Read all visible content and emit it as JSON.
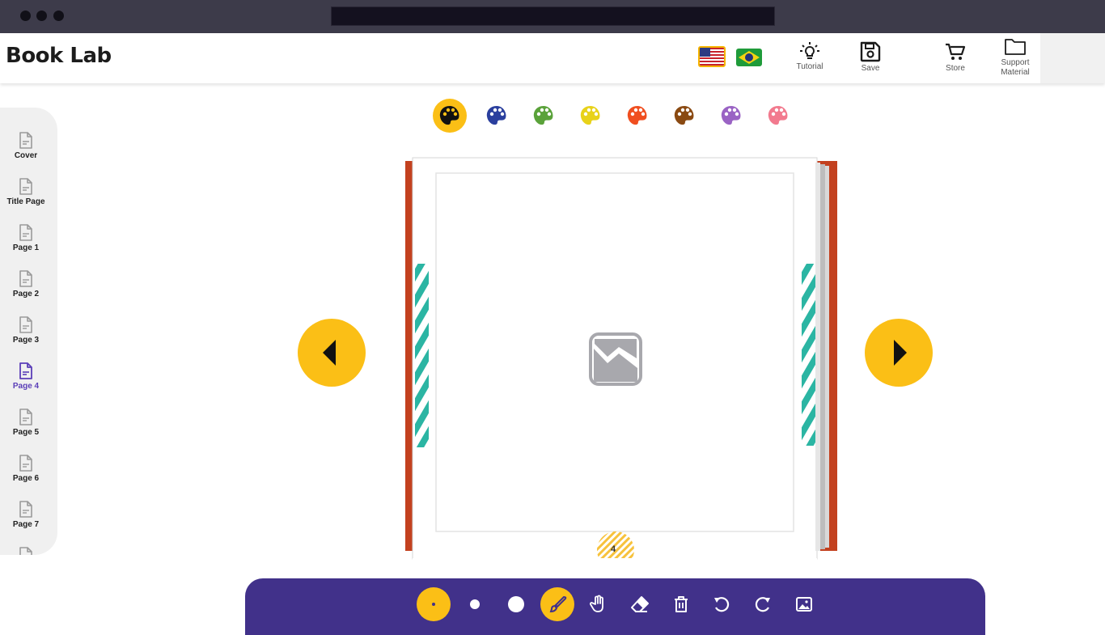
{
  "browser": {
    "address_bar": ""
  },
  "app": {
    "title": "Book Lab"
  },
  "header": {
    "languages": [
      "en-US",
      "pt-BR"
    ],
    "buttons": {
      "tutorial": "Tutorial",
      "save": "Save",
      "store": "Store",
      "support_line1": "Support",
      "support_line2": "Material"
    }
  },
  "sidebar": {
    "items": [
      {
        "label": "Cover"
      },
      {
        "label": "Title Page"
      },
      {
        "label": "Page 1"
      },
      {
        "label": "Page 2"
      },
      {
        "label": "Page 3"
      },
      {
        "label": "Page 4",
        "active": true
      },
      {
        "label": "Page 5"
      },
      {
        "label": "Page 6"
      },
      {
        "label": "Page 7"
      }
    ]
  },
  "palettes": [
    {
      "name": "black",
      "color": "#111111",
      "selected": true
    },
    {
      "name": "blue",
      "color": "#2a3f9e"
    },
    {
      "name": "green",
      "color": "#5aa23a"
    },
    {
      "name": "yellow",
      "color": "#e8d21a"
    },
    {
      "name": "orange",
      "color": "#f04e1f"
    },
    {
      "name": "brown",
      "color": "#8a4a12"
    },
    {
      "name": "purple",
      "color": "#9a63c4"
    },
    {
      "name": "pink",
      "color": "#f27a8e"
    }
  ],
  "book": {
    "page_number": "4",
    "cover_color": "#c3411f",
    "stripe_color": "#2bb5a3",
    "placeholder_icon": "image-placeholder-icon"
  },
  "toolbar": {
    "tools": [
      "small-brush-size",
      "medium-brush-size",
      "large-brush-size",
      "brush",
      "hand",
      "eraser",
      "trash",
      "undo",
      "redo",
      "image"
    ],
    "active_tools": [
      "small-brush-size",
      "brush"
    ]
  },
  "colors": {
    "accent": "#fbbf16",
    "toolbar": "#41318a",
    "active_page": "#5b3fb8"
  }
}
